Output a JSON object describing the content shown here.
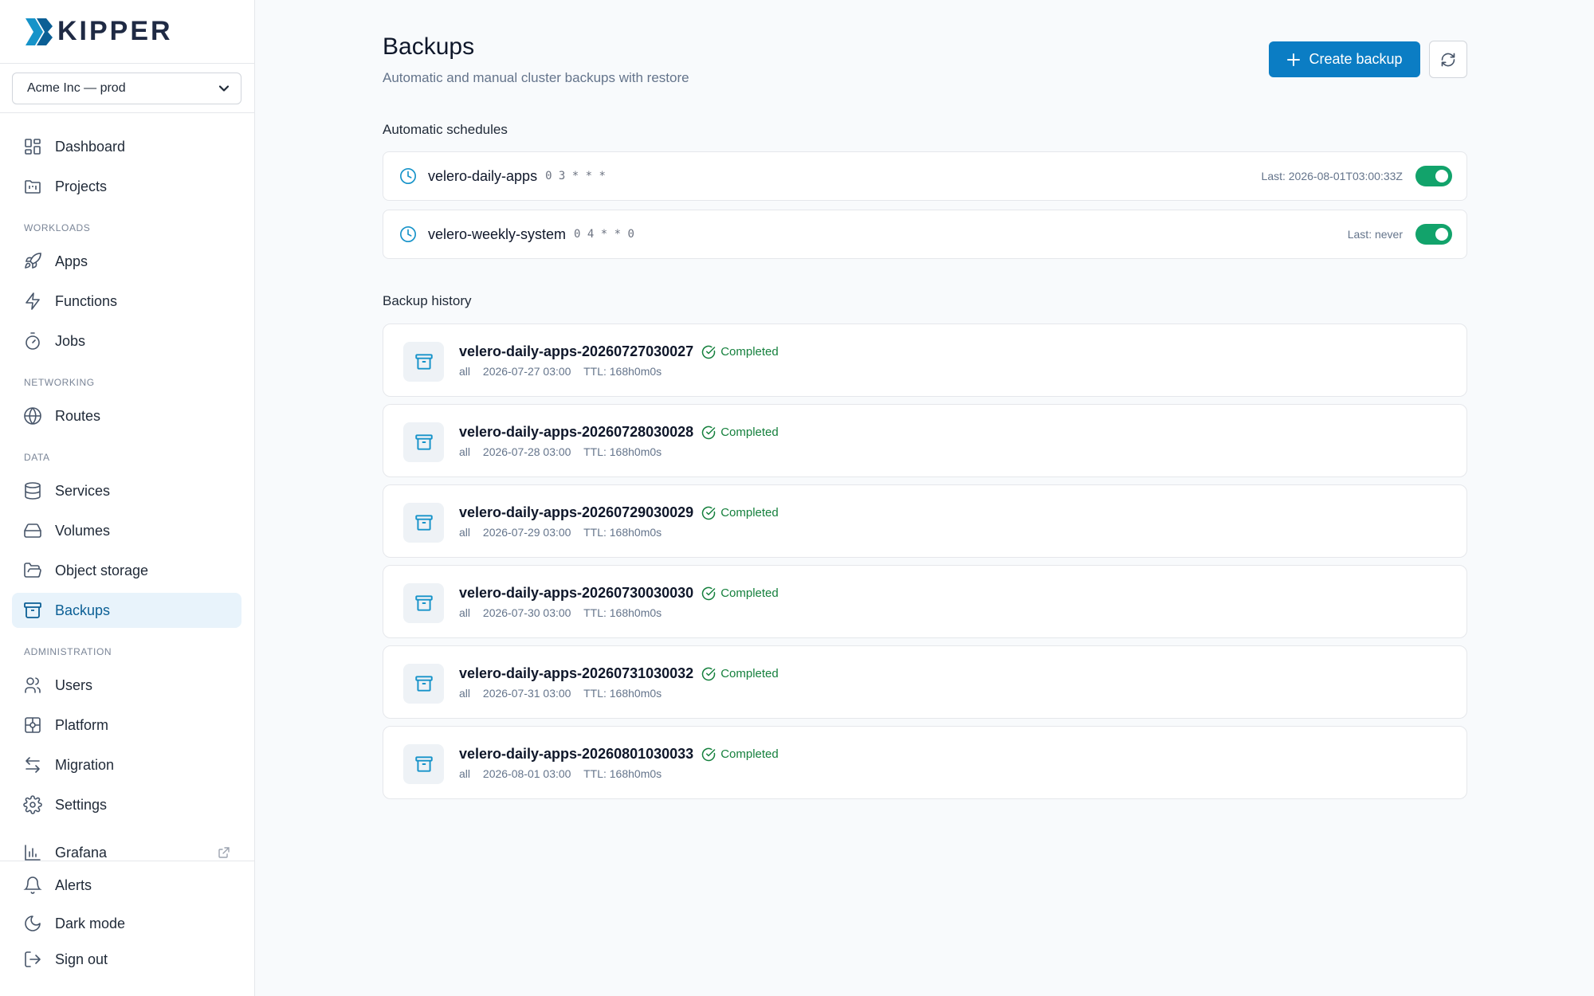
{
  "brand": {
    "name": "KIPPER"
  },
  "org_selector": {
    "value": "Acme Inc — prod"
  },
  "sidebar": {
    "items": {
      "dashboard": "Dashboard",
      "projects": "Projects",
      "apps": "Apps",
      "functions": "Functions",
      "jobs": "Jobs",
      "routes": "Routes",
      "services": "Services",
      "volumes": "Volumes",
      "object_storage": "Object storage",
      "backups": "Backups",
      "users": "Users",
      "platform": "Platform",
      "migration": "Migration",
      "settings": "Settings",
      "grafana": "Grafana"
    },
    "sections": {
      "workloads": "WORKLOADS",
      "networking": "NETWORKING",
      "data": "DATA",
      "administration": "ADMINISTRATION"
    },
    "bottom": {
      "alerts": "Alerts",
      "dark_mode": "Dark mode",
      "sign_out": "Sign out"
    },
    "active": "backups"
  },
  "header": {
    "title": "Backups",
    "subtitle": "Automatic and manual cluster backups with restore",
    "create_label": "Create backup"
  },
  "schedules": {
    "heading": "Automatic schedules",
    "items": [
      {
        "name": "velero-daily-apps",
        "cron": "0 3 * * *",
        "last": "Last: 2026-08-01T03:00:33Z",
        "enabled": true
      },
      {
        "name": "velero-weekly-system",
        "cron": "0 4 * * 0",
        "last": "Last: never",
        "enabled": true
      }
    ]
  },
  "history": {
    "heading": "Backup history",
    "items": [
      {
        "name": "velero-daily-apps-20260727030027",
        "status": "Completed",
        "scope": "all",
        "time": "2026-07-27 03:00",
        "ttl": "TTL: 168h0m0s"
      },
      {
        "name": "velero-daily-apps-20260728030028",
        "status": "Completed",
        "scope": "all",
        "time": "2026-07-28 03:00",
        "ttl": "TTL: 168h0m0s"
      },
      {
        "name": "velero-daily-apps-20260729030029",
        "status": "Completed",
        "scope": "all",
        "time": "2026-07-29 03:00",
        "ttl": "TTL: 168h0m0s"
      },
      {
        "name": "velero-daily-apps-20260730030030",
        "status": "Completed",
        "scope": "all",
        "time": "2026-07-30 03:00",
        "ttl": "TTL: 168h0m0s"
      },
      {
        "name": "velero-daily-apps-20260731030032",
        "status": "Completed",
        "scope": "all",
        "time": "2026-07-31 03:00",
        "ttl": "TTL: 168h0m0s"
      },
      {
        "name": "velero-daily-apps-20260801030033",
        "status": "Completed",
        "scope": "all",
        "time": "2026-08-01 03:00",
        "ttl": "TTL: 168h0m0s"
      }
    ]
  },
  "colors": {
    "primary": "#0b7dc4",
    "active_bg": "#e8f3fb",
    "success": "#15803d",
    "toggle_on": "#12a36b",
    "icon_accent": "#1693c9"
  }
}
